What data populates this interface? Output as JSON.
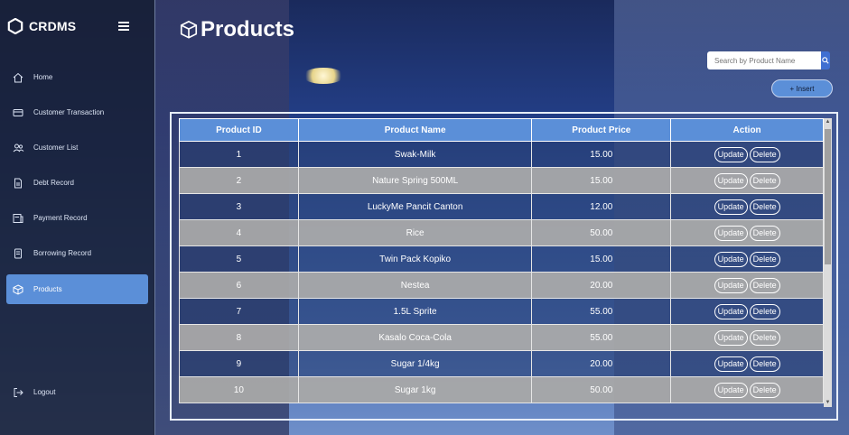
{
  "app": {
    "brand": "CRDMS"
  },
  "sidebar": {
    "items": [
      {
        "label": "Home",
        "icon": "home-icon",
        "active": false
      },
      {
        "label": "Customer Transaction",
        "icon": "transaction-icon",
        "active": false
      },
      {
        "label": "Customer List",
        "icon": "users-icon",
        "active": false
      },
      {
        "label": "Debt Record",
        "icon": "document-icon",
        "active": false
      },
      {
        "label": "Payment Record",
        "icon": "payment-icon",
        "active": false
      },
      {
        "label": "Borrowing Record",
        "icon": "record-icon",
        "active": false
      },
      {
        "label": "Products",
        "icon": "cube-icon",
        "active": true
      }
    ],
    "logout": {
      "label": "Logout",
      "icon": "logout-icon"
    }
  },
  "page": {
    "title": "Products"
  },
  "search": {
    "placeholder": "Search by Product Name",
    "value": ""
  },
  "insert": {
    "label": "+ Insert"
  },
  "table": {
    "headers": [
      "Product ID",
      "Product Name",
      "Product Price",
      "Action"
    ],
    "rows": [
      {
        "id": "1",
        "name": "Swak-Milk",
        "price": "15.00"
      },
      {
        "id": "2",
        "name": "Nature Spring 500ML",
        "price": "15.00"
      },
      {
        "id": "3",
        "name": "LuckyMe Pancit Canton",
        "price": "12.00"
      },
      {
        "id": "4",
        "name": "Rice",
        "price": "50.00"
      },
      {
        "id": "5",
        "name": "Twin Pack Kopiko",
        "price": "15.00"
      },
      {
        "id": "6",
        "name": "Nestea",
        "price": "20.00"
      },
      {
        "id": "7",
        "name": "1.5L Sprite",
        "price": "55.00"
      },
      {
        "id": "8",
        "name": "Kasalo Coca-Cola",
        "price": "55.00"
      },
      {
        "id": "9",
        "name": "Sugar 1/4kg",
        "price": "20.00"
      },
      {
        "id": "10",
        "name": "Sugar 1kg",
        "price": "50.00"
      }
    ],
    "update_label": "Update",
    "delete_label": "Delete"
  },
  "colors": {
    "accent": "#5b8fd8",
    "sidebar_bg": "#182034",
    "row_gray": "#a8a8a8"
  }
}
